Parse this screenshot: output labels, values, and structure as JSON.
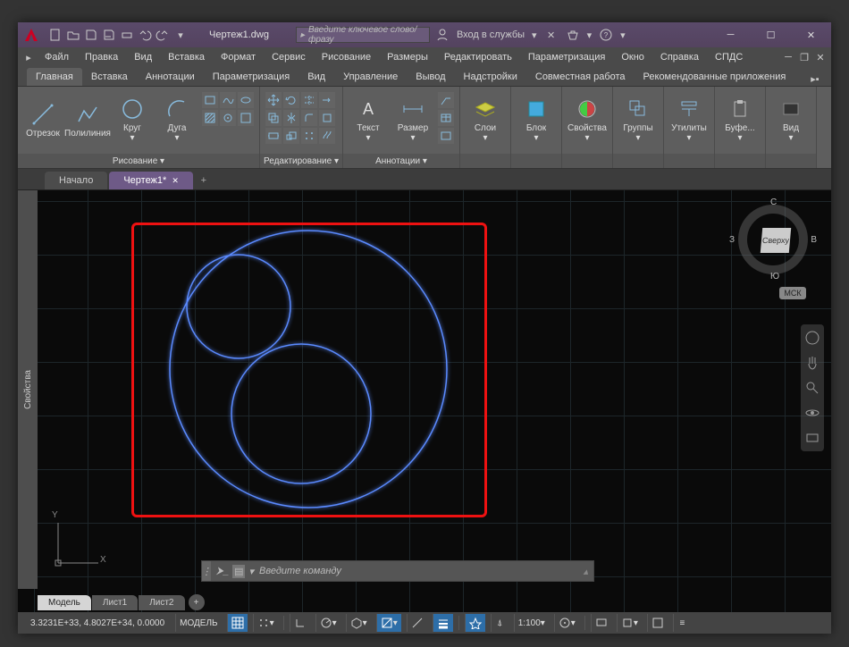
{
  "titlebar": {
    "filename": "Чертеж1.dwg",
    "search_placeholder": "Введите ключевое слово/фразу",
    "signin": "Вход в службы"
  },
  "menu": [
    "Файл",
    "Правка",
    "Вид",
    "Вставка",
    "Формат",
    "Сервис",
    "Рисование",
    "Размеры",
    "Редактировать",
    "Параметризация",
    "Окно",
    "Справка",
    "СПДС"
  ],
  "ribbon_tabs": [
    "Главная",
    "Вставка",
    "Аннотации",
    "Параметризация",
    "Вид",
    "Управление",
    "Вывод",
    "Надстройки",
    "Совместная работа",
    "Рекомендованные приложения"
  ],
  "panels": {
    "draw": {
      "title": "Рисование ▾",
      "b": [
        {
          "n": "line",
          "l": "Отрезок"
        },
        {
          "n": "polyline",
          "l": "Полилиния"
        },
        {
          "n": "circle",
          "l": "Круг"
        },
        {
          "n": "arc",
          "l": "Дуга"
        }
      ]
    },
    "modify": {
      "title": "Редактирование ▾"
    },
    "annot": {
      "title": "Аннотации ▾",
      "b": [
        {
          "n": "text",
          "l": "Текст"
        },
        {
          "n": "dim",
          "l": "Размер"
        }
      ]
    },
    "layers": {
      "title": "",
      "b": [
        {
          "n": "layers",
          "l": "Слои"
        }
      ]
    },
    "block": {
      "title": "",
      "b": [
        {
          "n": "block",
          "l": "Блок"
        }
      ]
    },
    "props": {
      "title": "",
      "b": [
        {
          "n": "props",
          "l": "Свойства"
        }
      ]
    },
    "groups": {
      "title": "",
      "b": [
        {
          "n": "groups",
          "l": "Группы"
        }
      ]
    },
    "utils": {
      "title": "",
      "b": [
        {
          "n": "utils",
          "l": "Утилиты"
        }
      ]
    },
    "clip": {
      "title": "",
      "b": [
        {
          "n": "clip",
          "l": "Буфе..."
        }
      ]
    },
    "view": {
      "title": "",
      "b": [
        {
          "n": "view",
          "l": "Вид"
        }
      ]
    }
  },
  "doctabs": {
    "start": "Начало",
    "active": "Чертеж1*"
  },
  "palette": {
    "properties": "Свойства"
  },
  "viewcube": {
    "face": "Сверху",
    "n": "С",
    "s": "Ю",
    "e": "В",
    "w": "З",
    "cs": "МСК"
  },
  "cmd": {
    "placeholder": "Введите команду"
  },
  "layouts": [
    "Модель",
    "Лист1",
    "Лист2"
  ],
  "status": {
    "coords": "3.3231E+33, 4.8027E+34, 0.0000",
    "space": "МОДЕЛЬ",
    "scale": "1:100"
  },
  "ucs": {
    "x": "X",
    "y": "Y"
  }
}
